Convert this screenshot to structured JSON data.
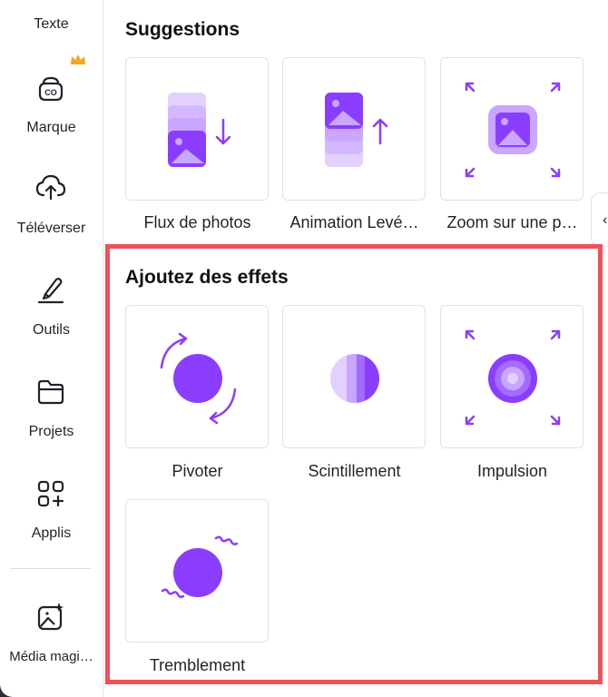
{
  "sidebar": {
    "items": [
      {
        "label": "Texte",
        "icon": "text-icon"
      },
      {
        "label": "Marque",
        "icon": "brand-icon",
        "badge_icon": "crown-icon"
      },
      {
        "label": "Téléverser",
        "icon": "cloud-upload-icon"
      },
      {
        "label": "Outils",
        "icon": "pen-tool-icon"
      },
      {
        "label": "Projets",
        "icon": "folder-icon"
      },
      {
        "label": "Applis",
        "icon": "apps-grid-icon"
      },
      {
        "label": "Média magi…",
        "icon": "magic-media-icon"
      }
    ]
  },
  "suggestions": {
    "title": "Suggestions",
    "items": [
      {
        "label": "Flux de photos",
        "icon": "photo-flow-icon"
      },
      {
        "label": "Animation Levé…",
        "icon": "rise-animation-icon"
      },
      {
        "label": "Zoom sur une p…",
        "icon": "zoom-photo-icon"
      }
    ]
  },
  "effects": {
    "title": "Ajoutez des effets",
    "items": [
      {
        "label": "Pivoter",
        "icon": "rotate-effect-icon"
      },
      {
        "label": "Scintillement",
        "icon": "flicker-effect-icon"
      },
      {
        "label": "Impulsion",
        "icon": "pulse-effect-icon"
      },
      {
        "label": "Tremblement",
        "icon": "shake-effect-icon"
      }
    ]
  },
  "colors": {
    "accent": "#8b3dff",
    "accent_light": "#c9a6ff",
    "accent_pale": "#e2d1ff",
    "highlight": "#ef5157",
    "crown": "#f5a623"
  }
}
